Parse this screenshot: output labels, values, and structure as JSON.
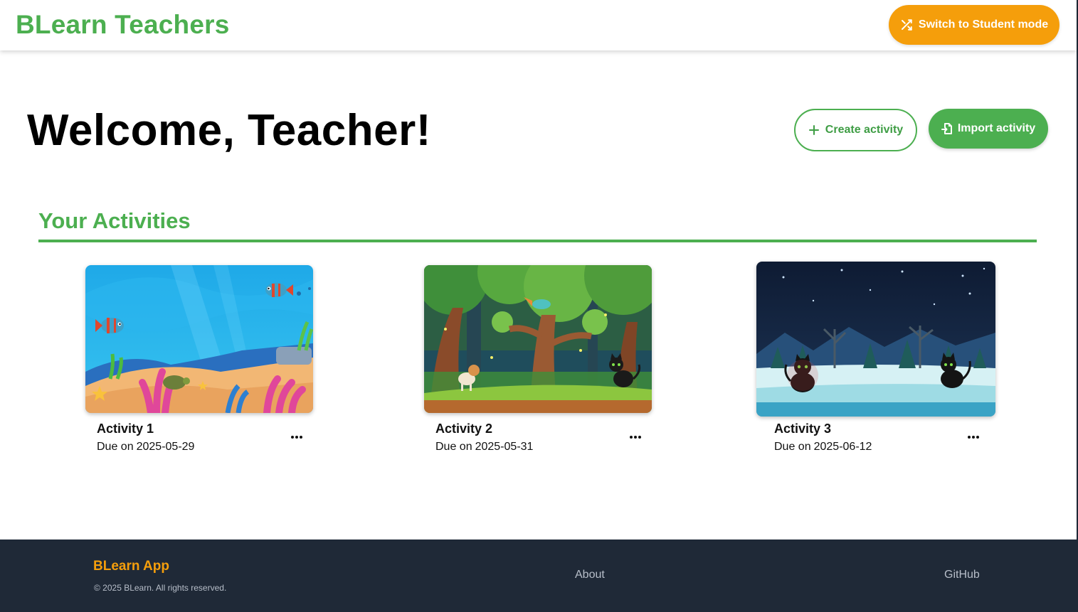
{
  "header": {
    "brand": "BLearn Teachers",
    "switch_label": "Switch to Student mode"
  },
  "main": {
    "welcome": "Welcome, Teacher!",
    "create_label": "Create activity",
    "import_label": "Import activity",
    "section_title": "Your Activities",
    "activities": [
      {
        "title": "Activity 1",
        "due_prefix": "Due on",
        "due_date": "2025-05-29",
        "scene": "underwater"
      },
      {
        "title": "Activity 2",
        "due_prefix": "Due on",
        "due_date": "2025-05-31",
        "scene": "forest"
      },
      {
        "title": "Activity 3",
        "due_prefix": "Due on",
        "due_date": "2025-06-12",
        "scene": "snowy-night"
      }
    ]
  },
  "footer": {
    "brand": "BLearn App",
    "copyright": "© 2025 BLearn. All rights reserved.",
    "links": [
      "About",
      "GitHub"
    ]
  },
  "colors": {
    "primary_green": "#4caf50",
    "accent_orange": "#f59e0b",
    "footer_bg": "#1f2937"
  },
  "icons": {
    "switch": "shuffle-icon",
    "create": "plus-icon",
    "import": "file-import-icon",
    "more": "more-horizontal-icon"
  }
}
